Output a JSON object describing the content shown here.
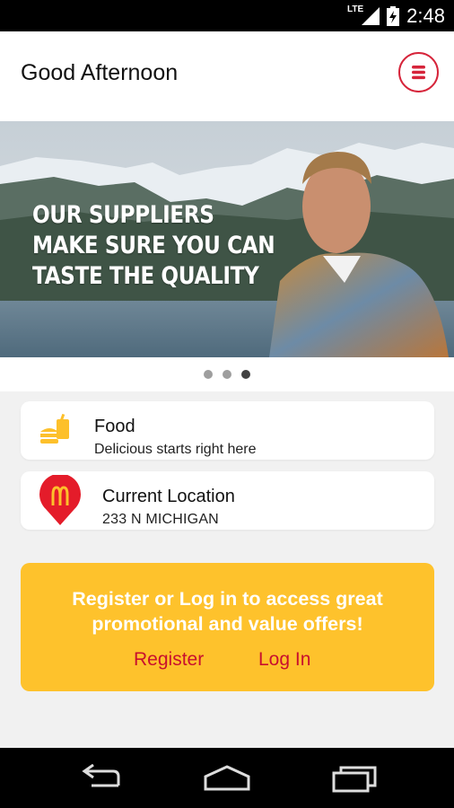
{
  "status_bar": {
    "time": "2:48",
    "network": "LTE"
  },
  "header": {
    "greeting": "Good Afternoon",
    "menu_icon": "menu-icon"
  },
  "banner": {
    "lines": [
      "OUR SUPPLIERS",
      "MAKE SURE YOU CAN",
      "TASTE THE QUALITY"
    ],
    "page_count": 3,
    "active_page": 3
  },
  "cards": {
    "food": {
      "title": "Food",
      "subtitle": "Delicious starts right here",
      "icon": "food-icon"
    },
    "location": {
      "title": "Current Location",
      "subtitle": "233 N MICHIGAN",
      "icon": "location-pin-icon"
    }
  },
  "promo": {
    "line1": "Register or Log in to access great",
    "line2": "promotional and value offers!",
    "register_label": "Register",
    "login_label": "Log In"
  },
  "colors": {
    "accent_red": "#d6243a",
    "promo_yellow": "#fec22c",
    "link_red": "#c8102e",
    "background": "#f1f1f1"
  }
}
